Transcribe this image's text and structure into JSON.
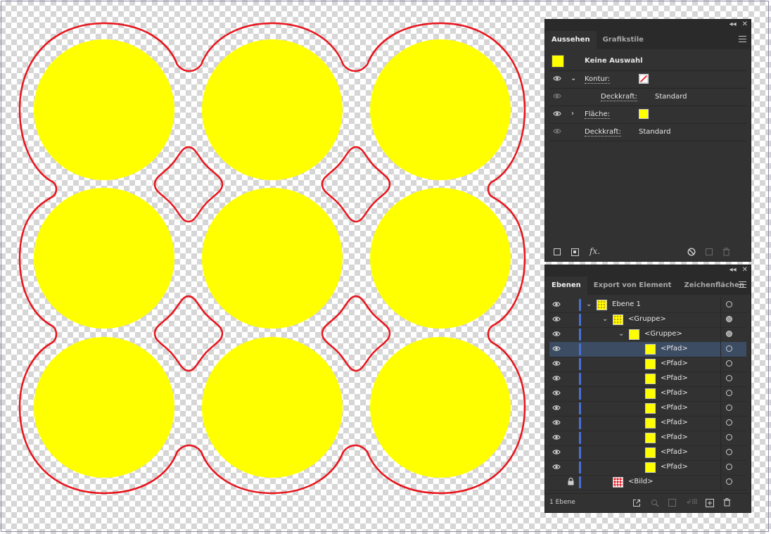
{
  "appearance_panel": {
    "tabs": [
      {
        "label": "Aussehen",
        "active": true
      },
      {
        "label": "Grafikstile",
        "active": false
      }
    ],
    "header_label": "Keine Auswahl",
    "header_swatch_color": "#ffff00",
    "rows": {
      "kontur": {
        "label": "Kontur:",
        "swatch": "none-red-slash"
      },
      "kontur_deckkraft": {
        "label": "Deckkraft:",
        "value": "Standard"
      },
      "flaeche": {
        "label": "Fläche:",
        "swatch_color": "#ffff00"
      },
      "deckkraft": {
        "label": "Deckkraft:",
        "value": "Standard"
      }
    },
    "footer_icons": [
      "new-stroke-icon",
      "new-fill-icon",
      "fx-icon",
      "clear-appearance-icon",
      "duplicate-icon",
      "delete-icon"
    ],
    "fx_label": "fx."
  },
  "layers_panel": {
    "tabs": [
      {
        "label": "Ebenen",
        "active": true
      },
      {
        "label": "Export von Element",
        "active": false
      },
      {
        "label": "Zeichenflächen",
        "active": false
      }
    ],
    "rows": [
      {
        "name": "Ebene 1",
        "indent": 0,
        "expanded": true,
        "thumb": "layer",
        "visible": true,
        "locked": false,
        "target_filled": false,
        "selected": false
      },
      {
        "name": "<Gruppe>",
        "indent": 1,
        "expanded": true,
        "thumb": "group",
        "visible": true,
        "locked": false,
        "target_filled": true,
        "selected": false
      },
      {
        "name": "<Gruppe>",
        "indent": 2,
        "expanded": true,
        "thumb": "yellow",
        "visible": true,
        "locked": false,
        "target_filled": true,
        "selected": false
      },
      {
        "name": "<Pfad>",
        "indent": 3,
        "expanded": false,
        "thumb": "yellow",
        "visible": true,
        "locked": false,
        "target_filled": false,
        "selected": true
      },
      {
        "name": "<Pfad>",
        "indent": 3,
        "expanded": false,
        "thumb": "yellow",
        "visible": true,
        "locked": false,
        "target_filled": false,
        "selected": false
      },
      {
        "name": "<Pfad>",
        "indent": 3,
        "expanded": false,
        "thumb": "yellow",
        "visible": true,
        "locked": false,
        "target_filled": false,
        "selected": false
      },
      {
        "name": "<Pfad>",
        "indent": 3,
        "expanded": false,
        "thumb": "yellow",
        "visible": true,
        "locked": false,
        "target_filled": false,
        "selected": false
      },
      {
        "name": "<Pfad>",
        "indent": 3,
        "expanded": false,
        "thumb": "yellow",
        "visible": true,
        "locked": false,
        "target_filled": false,
        "selected": false
      },
      {
        "name": "<Pfad>",
        "indent": 3,
        "expanded": false,
        "thumb": "yellow",
        "visible": true,
        "locked": false,
        "target_filled": false,
        "selected": false
      },
      {
        "name": "<Pfad>",
        "indent": 3,
        "expanded": false,
        "thumb": "yellow",
        "visible": true,
        "locked": false,
        "target_filled": false,
        "selected": false
      },
      {
        "name": "<Pfad>",
        "indent": 3,
        "expanded": false,
        "thumb": "yellow",
        "visible": true,
        "locked": false,
        "target_filled": false,
        "selected": false
      },
      {
        "name": "<Pfad>",
        "indent": 3,
        "expanded": false,
        "thumb": "yellow",
        "visible": true,
        "locked": false,
        "target_filled": false,
        "selected": false
      },
      {
        "name": "<Bild>",
        "indent": 1,
        "expanded": false,
        "thumb": "image",
        "visible": false,
        "locked": true,
        "target_filled": false,
        "selected": false
      }
    ],
    "footer_count": "1 Ebene",
    "footer_icons": [
      "export-icon",
      "locate-icon",
      "clipping-mask-icon",
      "new-sublayer-icon",
      "new-layer-icon",
      "delete-icon"
    ]
  },
  "artwork": {
    "circle_color": "#ffff00",
    "outline_color": "#e8141c"
  }
}
